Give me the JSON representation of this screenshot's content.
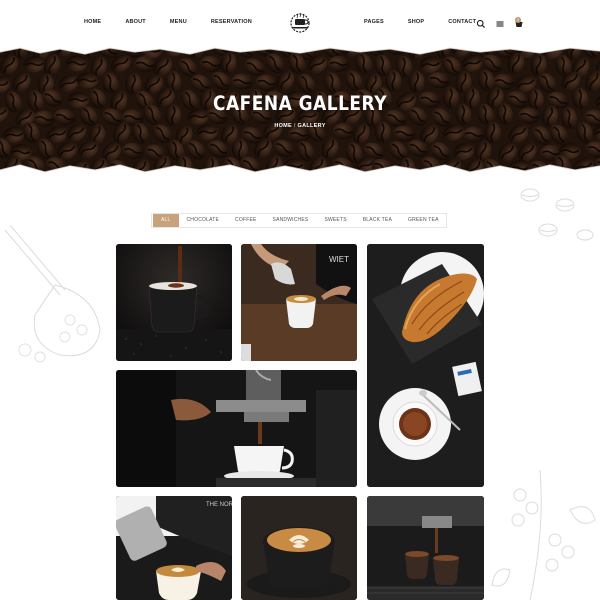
{
  "nav": {
    "left": [
      "HOME",
      "ABOUT",
      "MENU",
      "RESERVATION"
    ],
    "right": [
      "PAGES",
      "SHOP",
      "CONTACT"
    ]
  },
  "logo": {
    "icon": "coffee-cup-logo"
  },
  "header_icons": [
    "search-icon",
    "menu-icon",
    "cart-icon"
  ],
  "cart_count": "0",
  "hero": {
    "title": "CAFENA GALLERY",
    "breadcrumb_home": "HOME",
    "breadcrumb_sep": "/",
    "breadcrumb_current": "GALLERY"
  },
  "filters": [
    "ALL",
    "CHOCOLATE",
    "COFFEE",
    "SANDWICHES",
    "SWEETS",
    "BLACK TEA",
    "GREEN TEA"
  ],
  "active_filter": "ALL",
  "colors": {
    "accent": "#c8a27a",
    "dark": "#1c1a18",
    "text": "#222222"
  },
  "gallery": [
    {
      "name": "gallery-item-espresso-pour",
      "alt": "coffee pouring into black cup"
    },
    {
      "name": "gallery-item-latte-pour",
      "alt": "milk pouring into latte"
    },
    {
      "name": "gallery-item-croissant",
      "alt": "croissant and coffee flat lay"
    },
    {
      "name": "gallery-item-espresso-machine",
      "alt": "barista at espresso machine"
    },
    {
      "name": "gallery-item-latte-art-barista",
      "alt": "barista making latte art"
    },
    {
      "name": "gallery-item-latte-art-cup",
      "alt": "latte art in black cup"
    },
    {
      "name": "gallery-item-espresso-shot",
      "alt": "espresso shots extracting"
    }
  ]
}
